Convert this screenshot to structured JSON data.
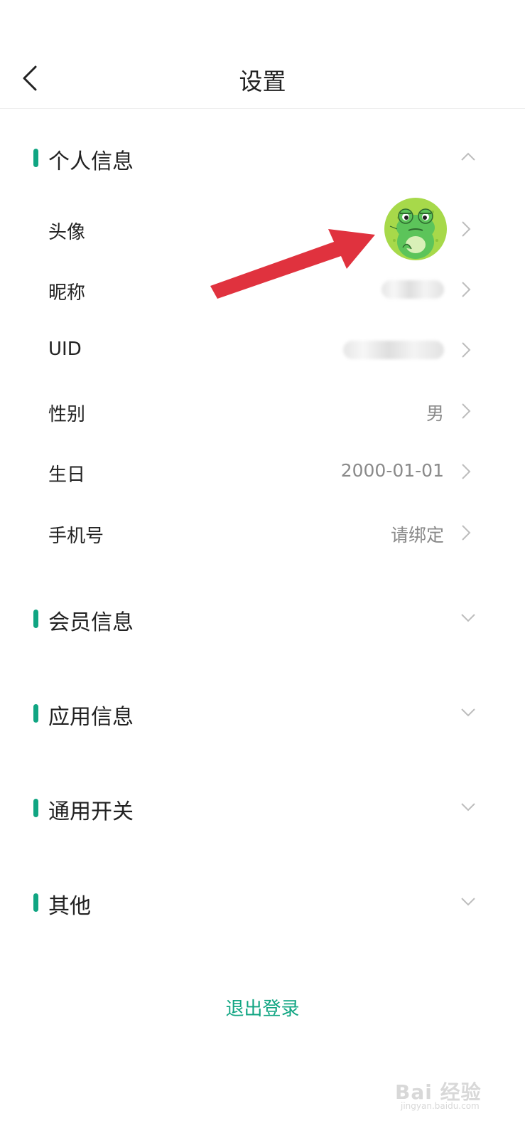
{
  "header": {
    "title": "设置"
  },
  "sections": [
    {
      "label": "个人信息",
      "expanded": true
    },
    {
      "label": "会员信息",
      "expanded": false
    },
    {
      "label": "应用信息",
      "expanded": false
    },
    {
      "label": "通用开关",
      "expanded": false
    },
    {
      "label": "其他",
      "expanded": false
    }
  ],
  "personal_rows": [
    {
      "label": "头像",
      "value_type": "avatar-image"
    },
    {
      "label": "昵称",
      "value_type": "blurred"
    },
    {
      "label": "UID",
      "value_type": "blurred"
    },
    {
      "label": "性别",
      "value": "男"
    },
    {
      "label": "生日",
      "value": "2000-01-01"
    },
    {
      "label": "手机号",
      "value": "请绑定"
    }
  ],
  "logout": {
    "label": "退出登录"
  },
  "watermark": {
    "text": "Bai 经验",
    "sub": "jingyan.baidu.com"
  },
  "colors": {
    "accent": "#10a582",
    "arrow": "#e0323e",
    "value_gray": "#8a8a8a"
  },
  "icons": {
    "back": "chevron-left-icon",
    "expanded": "chevron-up-icon",
    "collapsed": "chevron-down-icon",
    "row_arrow": "chevron-right-icon"
  }
}
